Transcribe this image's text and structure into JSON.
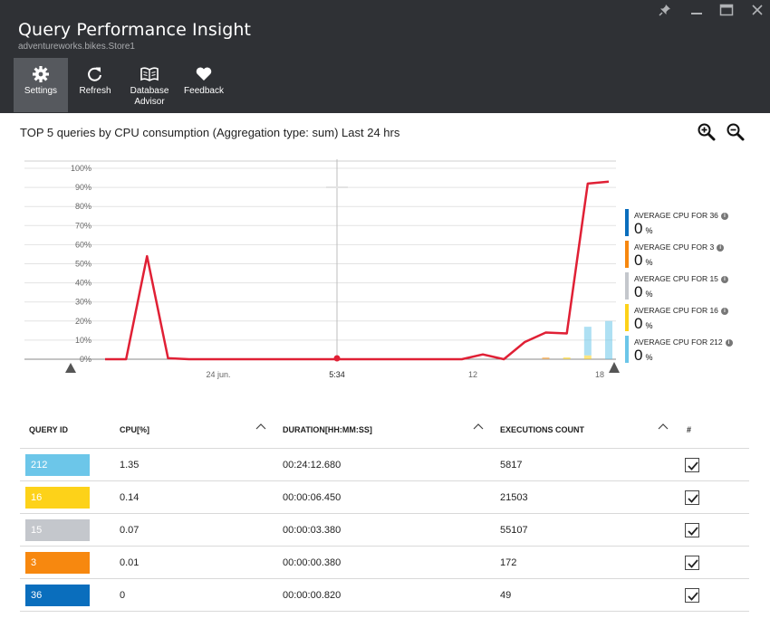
{
  "header": {
    "title": "Query Performance Insight",
    "subtitle": "adventureworks.bikes.Store1",
    "window_controls": [
      "pin-icon",
      "minimize-icon",
      "maximize-icon",
      "close-icon"
    ],
    "toolbar": {
      "settings": "Settings",
      "refresh": "Refresh",
      "database_advisor_line1": "Database",
      "database_advisor_line2": "Advisor",
      "feedback": "Feedback"
    }
  },
  "main": {
    "chart_title": "TOP 5 queries by CPU consumption (Aggregation type: sum) Last 24 hrs",
    "zoom_in_icon": "zoom-in-icon",
    "zoom_out_icon": "zoom-out-icon"
  },
  "chart_data": {
    "type": "line",
    "y_ticks": [
      "100%",
      "90%",
      "80%",
      "70%",
      "60%",
      "50%",
      "40%",
      "30%",
      "20%",
      "10%",
      "0%"
    ],
    "x_ticks": [
      "24 jun.",
      "5:34",
      "12",
      "18"
    ],
    "ylim": [
      0,
      100
    ],
    "grid": true,
    "series": [
      {
        "color": "#e02035",
        "values": [
          0,
          0,
          54,
          0.5,
          0,
          0,
          0,
          0,
          0,
          0,
          0,
          0,
          0,
          0,
          0,
          0,
          0,
          0,
          2.5,
          0,
          9,
          14,
          13.5,
          92,
          93
        ]
      }
    ],
    "bars": [
      {
        "color": "#f59a2b",
        "values": [
          0,
          0,
          0,
          0,
          0,
          0,
          0,
          0,
          0,
          0,
          0,
          0,
          0,
          0,
          0,
          0,
          0,
          0,
          0,
          0,
          0,
          1,
          0,
          0,
          0
        ]
      },
      {
        "color": "#fdd219",
        "values": [
          0,
          0,
          0,
          0,
          0,
          0,
          0,
          0,
          0,
          0,
          0,
          0,
          0,
          0,
          0,
          0,
          0,
          0,
          0,
          0,
          0,
          0,
          1,
          2,
          0
        ]
      },
      {
        "color": "#6cc6e9",
        "values": [
          0,
          0,
          0,
          0,
          0,
          0,
          0,
          0,
          0,
          0,
          0,
          0,
          0,
          0,
          0,
          0,
          0,
          0,
          0,
          0,
          0,
          0,
          0,
          15,
          20
        ]
      }
    ],
    "marker_label": "5:34",
    "legend": [
      {
        "label": "AVERAGE CPU FOR 36",
        "value": "0",
        "unit": "%",
        "color": "#0a6ebd"
      },
      {
        "label": "AVERAGE CPU FOR 3",
        "value": "0",
        "unit": "%",
        "color": "#f7880f"
      },
      {
        "label": "AVERAGE CPU FOR 15",
        "value": "0",
        "unit": "%",
        "color": "#c4c7cc"
      },
      {
        "label": "AVERAGE CPU FOR 16",
        "value": "0",
        "unit": "%",
        "color": "#fdd219"
      },
      {
        "label": "AVERAGE CPU FOR 212",
        "value": "0",
        "unit": "%",
        "color": "#6cc6e9"
      }
    ],
    "legend_info_glyph": "i"
  },
  "table": {
    "columns": [
      "QUERY ID",
      "CPU[%]",
      "DURATION[HH:MM:SS]",
      "EXECUTIONS COUNT",
      "#"
    ],
    "rows": [
      {
        "id": "212",
        "color": "#6cc6e9",
        "cpu": "1.35",
        "duration": "00:24:12.680",
        "executions": "5817",
        "checked": true
      },
      {
        "id": "16",
        "color": "#fdd219",
        "cpu": "0.14",
        "duration": "00:00:06.450",
        "executions": "21503",
        "checked": true
      },
      {
        "id": "15",
        "color": "#c4c7cc",
        "cpu": "0.07",
        "duration": "00:00:03.380",
        "executions": "55107",
        "checked": true
      },
      {
        "id": "3",
        "color": "#f7880f",
        "cpu": "0.01",
        "duration": "00:00:00.380",
        "executions": "172",
        "checked": true
      },
      {
        "id": "36",
        "color": "#0a6ebd",
        "cpu": "0",
        "duration": "00:00:00.820",
        "executions": "49",
        "checked": true
      }
    ]
  }
}
